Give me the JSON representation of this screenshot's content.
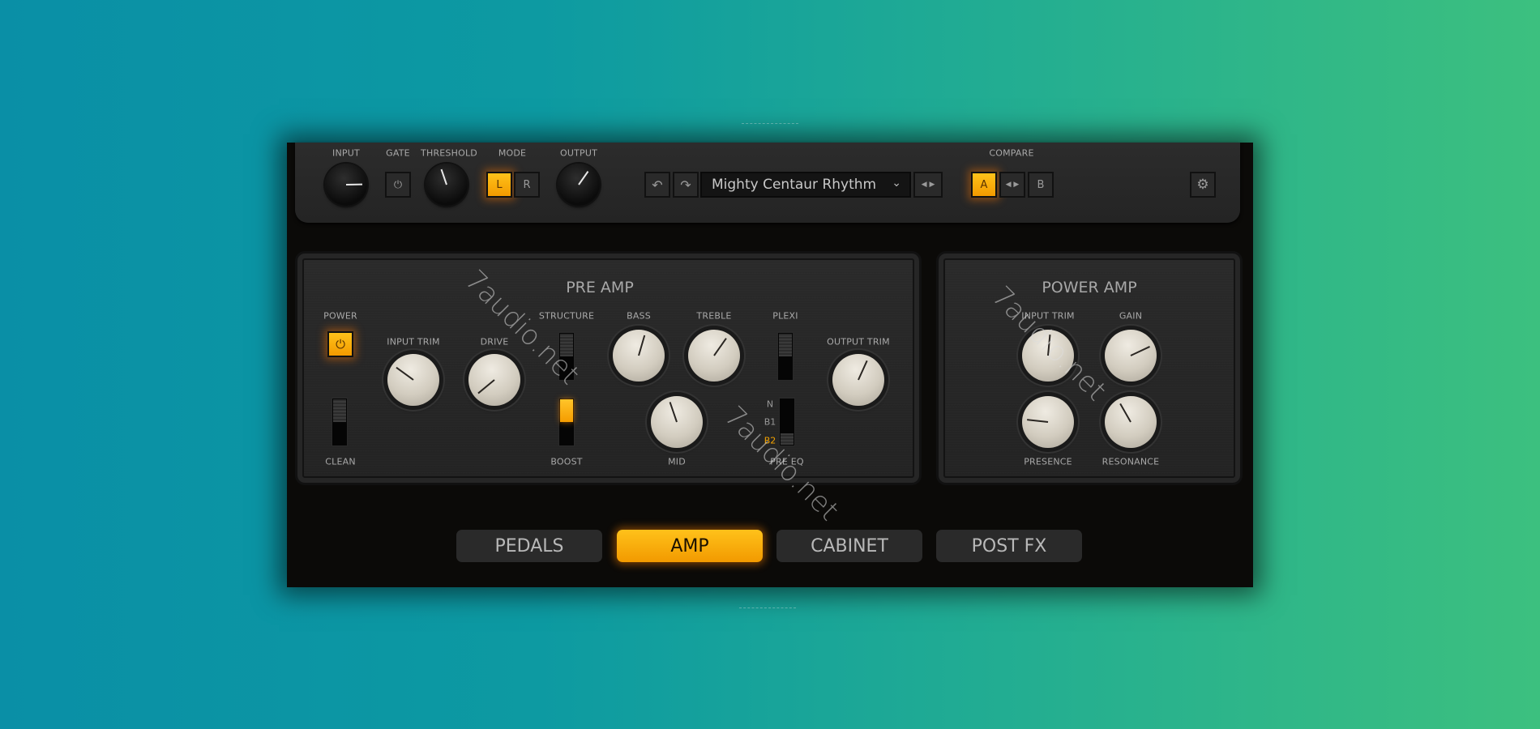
{
  "colors": {
    "accent": "#f5a500",
    "panel": "#232323",
    "background_left": "#0a8fa6",
    "background_right": "#3cc07f"
  },
  "topbar": {
    "input": {
      "label": "INPUT",
      "value": 0.83
    },
    "gate": {
      "label": "GATE",
      "icon": "power-icon",
      "on": false
    },
    "threshold": {
      "label": "THRESHOLD",
      "value": 0.43
    },
    "mode": {
      "label": "MODE",
      "options": [
        "L",
        "R"
      ],
      "selected": "L"
    },
    "output": {
      "label": "OUTPUT",
      "value": 0.63
    },
    "undo_icon": "undo-icon",
    "redo_icon": "redo-icon",
    "preset": {
      "name": "Mighty Centaur Rhythm",
      "chevron": "⌄",
      "prev": "◀",
      "next": "▶"
    },
    "compare": {
      "label": "COMPARE",
      "a": "A",
      "b": "B",
      "arrows": "◀ ▶",
      "selected": "A"
    },
    "settings_icon": "gear-icon"
  },
  "pre_amp": {
    "title": "PRE AMP",
    "power": {
      "label": "POWER",
      "on": true
    },
    "clean": {
      "label": "CLEAN"
    },
    "input_trim": {
      "label": "INPUT TRIM",
      "value": 0.3
    },
    "drive": {
      "label": "DRIVE",
      "value": 0.02
    },
    "structure": {
      "label": "STRUCTURE"
    },
    "boost": {
      "label": "BOOST",
      "on": true
    },
    "bass": {
      "label": "BASS",
      "value": 0.56
    },
    "treble": {
      "label": "TREBLE",
      "value": 0.63
    },
    "mid": {
      "label": "MID",
      "value": 0.43
    },
    "plexi": {
      "label": "PLEXI"
    },
    "pre_eq": {
      "label": "PRE EQ",
      "options": [
        "N",
        "B1",
        "B2"
      ],
      "selected": "B2"
    },
    "output_trim": {
      "label": "OUTPUT TRIM",
      "value": 0.59
    }
  },
  "power_amp": {
    "title": "POWER AMP",
    "input_trim": {
      "label": "INPUT TRIM",
      "value": 0.52
    },
    "gain": {
      "label": "GAIN",
      "value": 0.74
    },
    "presence": {
      "label": "PRESENCE",
      "value": 0.19
    },
    "resonance": {
      "label": "RESONANCE",
      "value": 0.39
    }
  },
  "tabs": [
    {
      "label": "PEDALS"
    },
    {
      "label": "AMP",
      "active": true
    },
    {
      "label": "CABINET"
    },
    {
      "label": "POST FX"
    }
  ],
  "watermark": "7audio.net"
}
